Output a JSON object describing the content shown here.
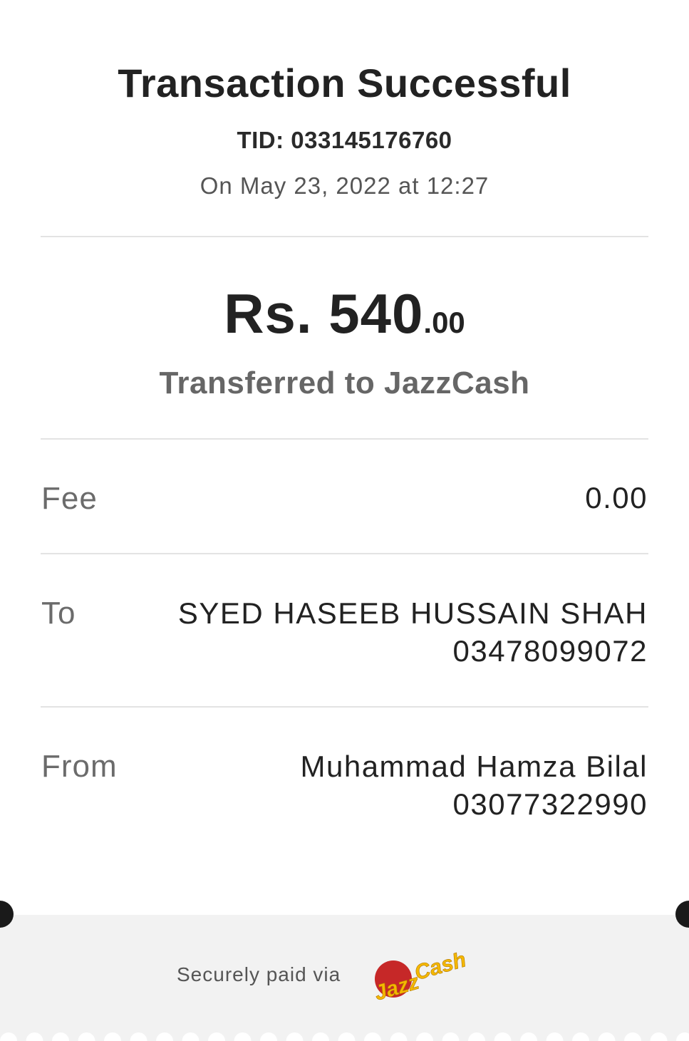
{
  "header": {
    "title": "Transaction Successful",
    "tid": "TID: 033145176760",
    "date": "On May 23, 2022 at 12:27"
  },
  "amount": {
    "main": "Rs. 540",
    "decimal": ".00",
    "description": "Transferred to JazzCash"
  },
  "details": {
    "fee": {
      "label": "Fee",
      "value": "0.00"
    },
    "to": {
      "label": "To",
      "name": "SYED HASEEB HUSSAIN SHAH",
      "number": "03478099072"
    },
    "from": {
      "label": "From",
      "name": "Muhammad Hamza Bilal",
      "number": "03077322990"
    }
  },
  "footer": {
    "secure_text": "Securely paid via",
    "logo_text_jazz": "Jazz",
    "logo_text_cash": "Cash",
    "logo_colors": {
      "jazz_circle": "#c62828",
      "text": "#f5b800"
    }
  },
  "colors": {
    "background": "#ffffff",
    "footer_bg": "#f2f2f2",
    "divider": "#e3e3e3",
    "notch": "#1a1a1a"
  }
}
